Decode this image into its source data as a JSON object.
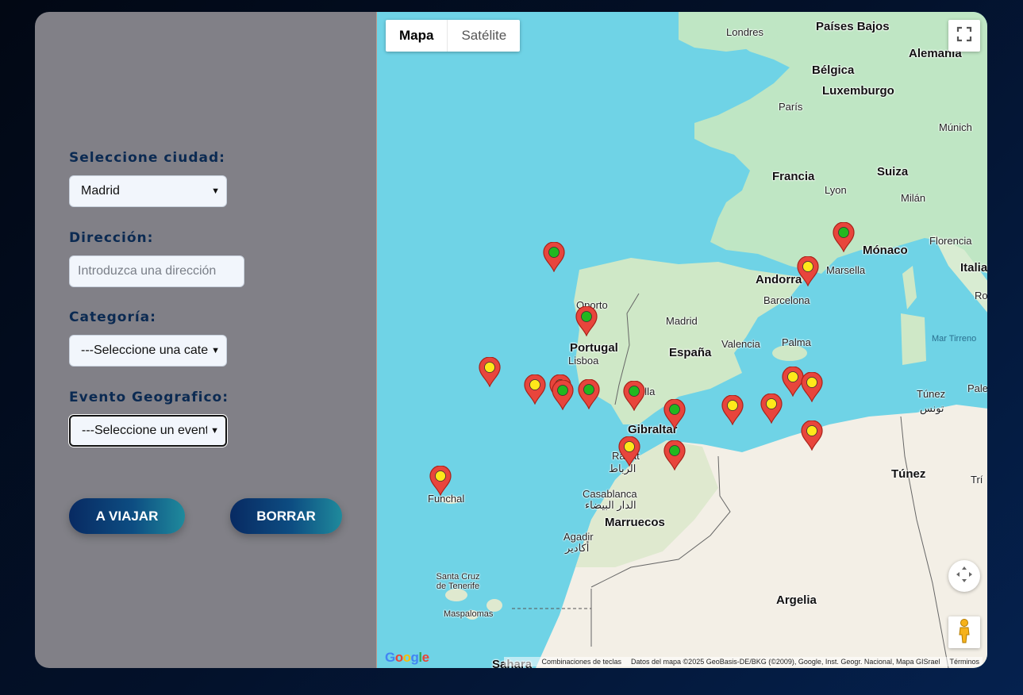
{
  "form": {
    "city_label": "Seleccione ciudad:",
    "city_value": "Madrid",
    "address_label": "Dirección:",
    "address_placeholder": "Introduzca una dirección",
    "category_label": "Categoría:",
    "category_value": "---Seleccione una categoría---",
    "event_label": "Evento Geografico:",
    "event_value": "---Seleccione un evento---",
    "travel_button": "A VIAJAR",
    "clear_button": "BORRAR"
  },
  "map": {
    "type_map": "Mapa",
    "type_satellite": "Satélite",
    "icons": {
      "fullscreen": "fullscreen-icon",
      "camera": "camera-control-icon",
      "pegman": "pegman-icon"
    },
    "google_logo": "Google",
    "footer": {
      "shortcuts": "Combinaciones de teclas",
      "data": "Datos del mapa ©2025 GeoBasis-DE/BKG (©2009), Google, Inst. Geogr. Nacional, Mapa GISrael",
      "terms": "Términos"
    },
    "labels": {
      "londres": "Londres",
      "paises_bajos": "Países Bajos",
      "alemania": "Alemania",
      "belgica": "Bélgica",
      "luxemburgo": "Luxemburgo",
      "paris": "París",
      "munich": "Múnich",
      "francia": "Francia",
      "suiza": "Suiza",
      "lyon": "Lyon",
      "milan": "Milán",
      "florencia": "Florencia",
      "italia": "Italia",
      "monaco": "Mónaco",
      "marsella": "Marsella",
      "andorra": "Andorra",
      "barcelona": "Barcelona",
      "oporto": "Oporto",
      "madrid": "Madrid",
      "portugal": "Portugal",
      "espana": "España",
      "valencia": "Valencia",
      "palma": "Palma",
      "mar_tirreno": "Mar Tirreno",
      "lisboa": "Lisboa",
      "sevilla": "Sevilla",
      "gibraltar": "Gibraltar",
      "tunez_city": "Túnez",
      "tunez_city_ar": "تونس",
      "rabat": "Rabat",
      "rabat_ar": "الرباط",
      "casablanca": "Casablanca",
      "casablanca_ar": "الدار البيضاء",
      "marruecos": "Marruecos",
      "tunez": "Túnez",
      "funchal": "Funchal",
      "agadir": "Agadir",
      "agadir_ar": "أكادير",
      "santa_cruz": "Santa Cruz de Tenerife",
      "maspalomas": "Maspalomas",
      "argelia": "Argelia",
      "roma": "Ro",
      "palermo": "Pale",
      "tripoli": "Trí",
      "sahara": "Sahara"
    },
    "markers": [
      {
        "color": "green"
      },
      {
        "color": "yellow"
      },
      {
        "color": "green"
      },
      {
        "color": "green"
      },
      {
        "color": "yellow"
      },
      {
        "color": "yellow"
      },
      {
        "color": "yellow"
      },
      {
        "color": "green"
      },
      {
        "color": "green"
      },
      {
        "color": "green"
      },
      {
        "color": "green"
      },
      {
        "color": "yellow"
      },
      {
        "color": "yellow"
      },
      {
        "color": "yellow"
      },
      {
        "color": "yellow"
      },
      {
        "color": "yellow"
      },
      {
        "color": "yellow"
      },
      {
        "color": "green"
      },
      {
        "color": "yellow"
      }
    ]
  }
}
